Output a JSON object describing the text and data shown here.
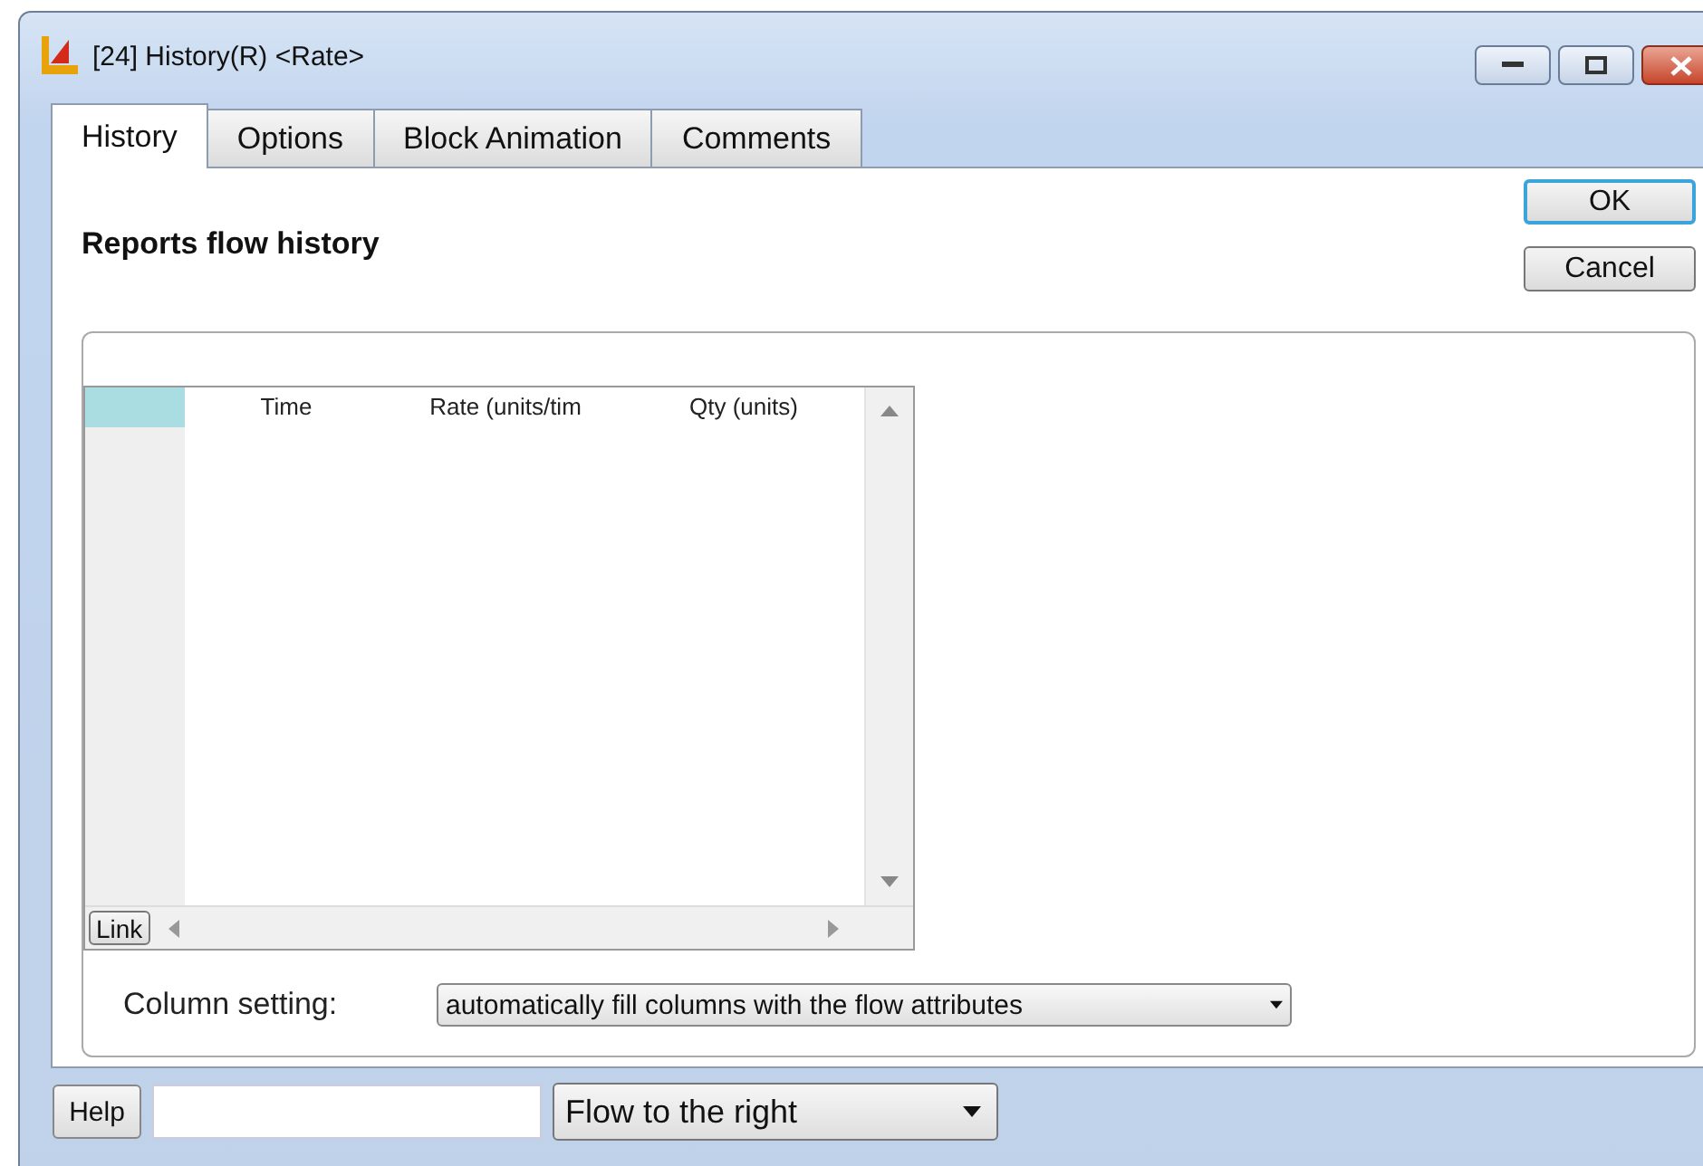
{
  "window": {
    "title": "[24] History(R) <Rate>"
  },
  "tabs": [
    {
      "label": "History",
      "selected": true
    },
    {
      "label": "Options",
      "selected": false
    },
    {
      "label": "Block Animation",
      "selected": false
    },
    {
      "label": "Comments",
      "selected": false
    }
  ],
  "heading": "Reports flow history",
  "buttons": [
    {
      "label": "OK",
      "default": true
    },
    {
      "label": "Cancel",
      "default": false
    }
  ],
  "table": {
    "columns": [
      "Time",
      "Rate (units/tim",
      "Qty (units)"
    ],
    "link_button": "Link"
  },
  "column_setting": {
    "label": "Column setting:",
    "value": "automatically fill columns with the flow attributes"
  },
  "footer": {
    "help_button": "Help",
    "direction": "Flow to the right"
  }
}
